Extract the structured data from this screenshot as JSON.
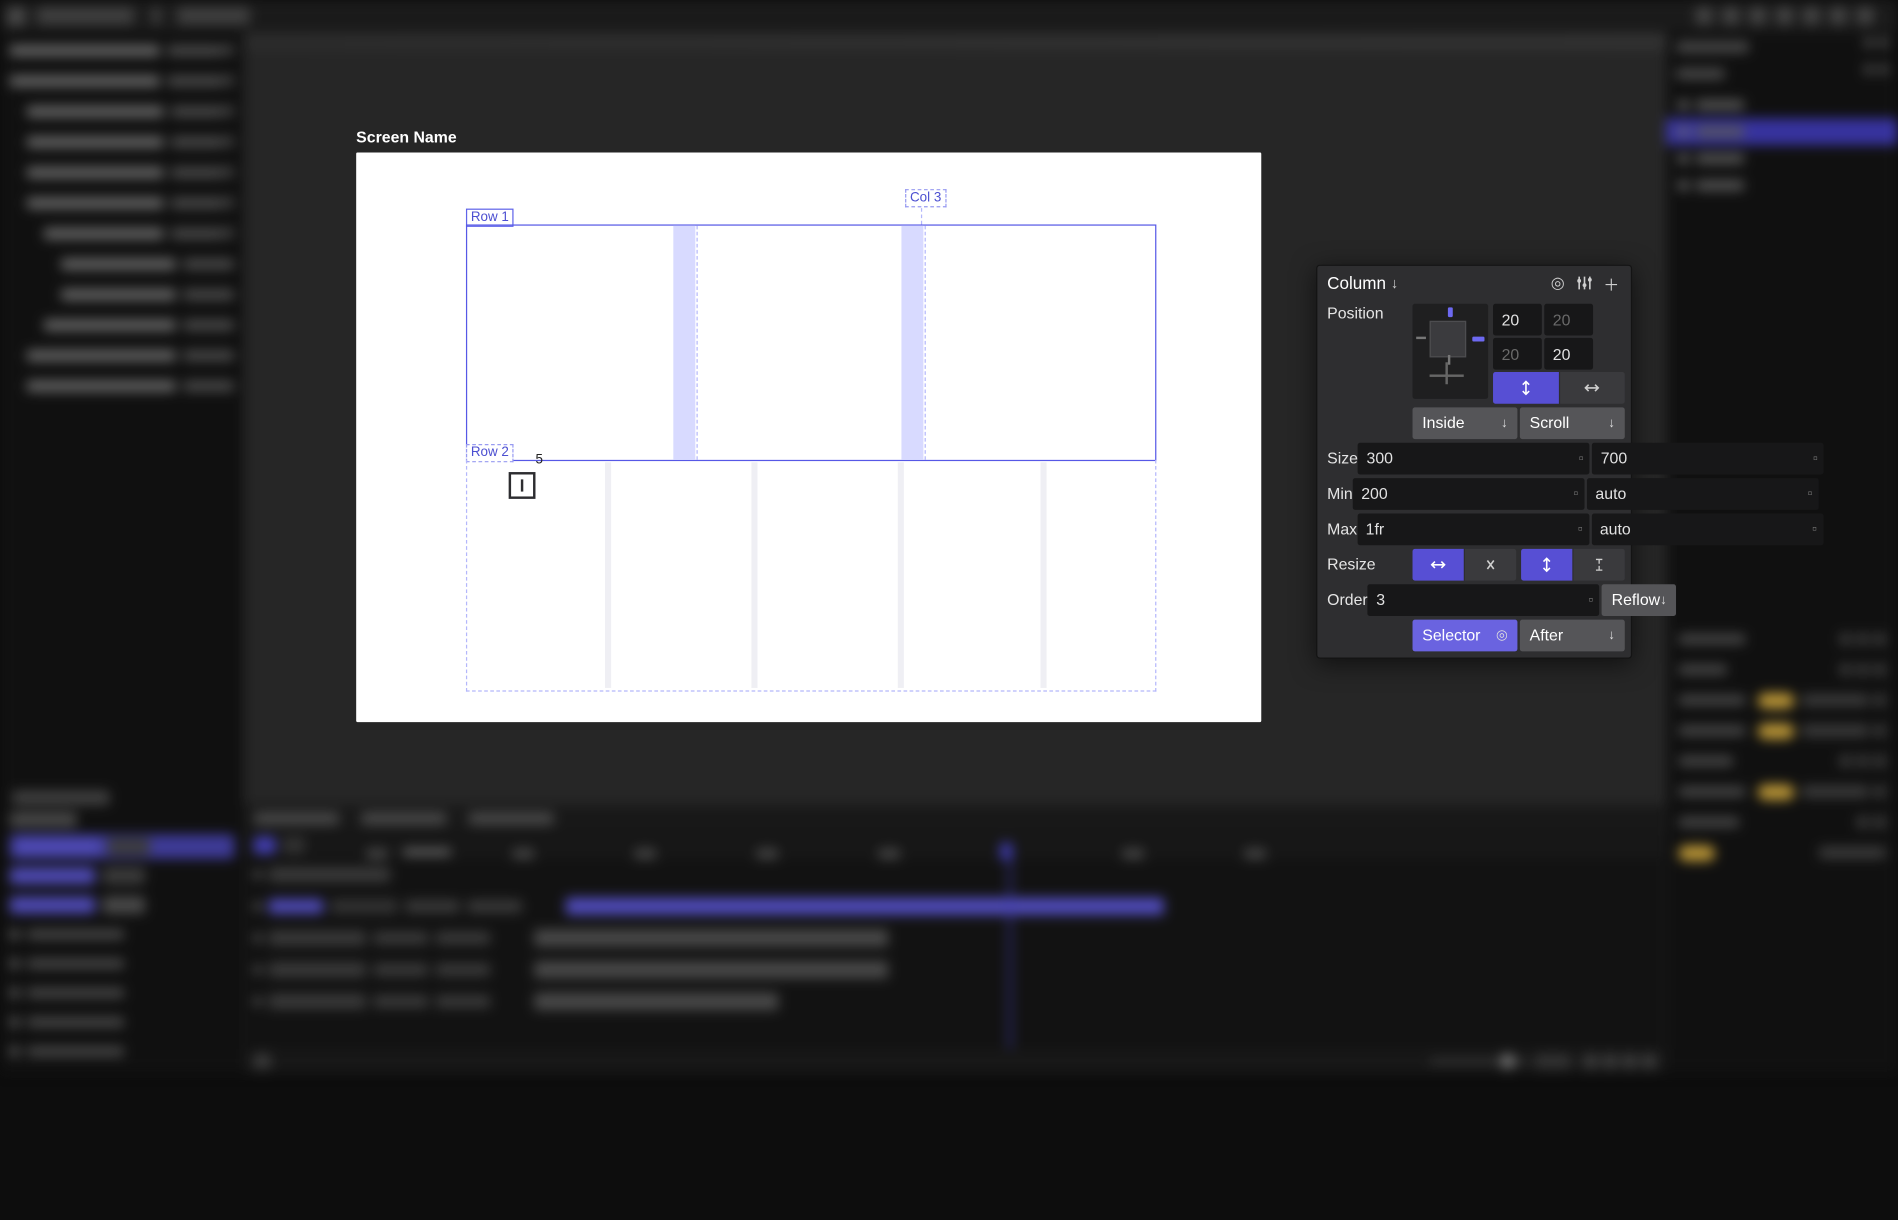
{
  "breadcrumb": {
    "project": "Project Name",
    "file": "File Name"
  },
  "canvas": {
    "screen_title": "Screen Name",
    "row1_label": "Row 1",
    "row2_label": "Row 2",
    "col3_label": "Col 3",
    "cursor_index": "5"
  },
  "inspector": {
    "title": "Column",
    "title_arrow": "↓",
    "labels": {
      "position": "Position",
      "size": "Size",
      "min": "Min",
      "max": "Max",
      "resize": "Resize",
      "order": "Order"
    },
    "position": {
      "top": "20",
      "right": "20",
      "bottom": "20",
      "left": "20",
      "dim_left": true,
      "dim_bottom": true
    },
    "overflow": {
      "inside": "Inside",
      "scroll": "Scroll"
    },
    "size": {
      "w": "300",
      "h": "700"
    },
    "min": {
      "w": "200",
      "h": "auto"
    },
    "max": {
      "w": "1fr",
      "h": "auto"
    },
    "order": {
      "value": "3",
      "reflow": "Reflow"
    },
    "selector": {
      "label": "Selector",
      "after": "After"
    }
  }
}
